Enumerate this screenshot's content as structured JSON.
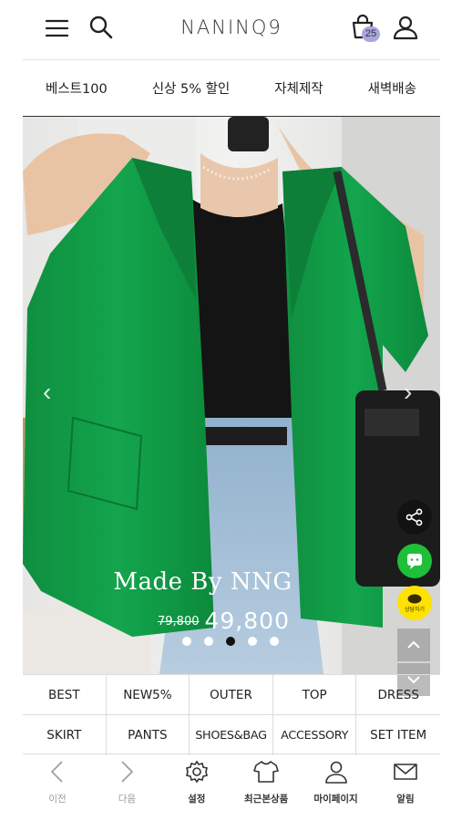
{
  "header": {
    "logo": "NANINQ9",
    "cart_count": "25",
    "icons": [
      "menu-icon",
      "search-icon",
      "cart-icon",
      "user-icon"
    ]
  },
  "category_nav": [
    {
      "label": "베스트100"
    },
    {
      "label": "신상 5% 할인"
    },
    {
      "label": "자체제작"
    },
    {
      "label": "새벽배송"
    }
  ],
  "hero": {
    "title": "Made By NNG",
    "old_price": "79,800",
    "price": "49,800",
    "slide_count": 5,
    "active_slide": 3
  },
  "grid": [
    {
      "label": "BEST"
    },
    {
      "label": "NEW5%"
    },
    {
      "label": "OUTER"
    },
    {
      "label": "TOP"
    },
    {
      "label": "DRESS"
    },
    {
      "label": "SKIRT"
    },
    {
      "label": "PANTS"
    },
    {
      "label": "SHOES&BAG"
    },
    {
      "label": "ACCESSORY"
    },
    {
      "label": "SET ITEM"
    }
  ],
  "floating": {
    "kakao_label": "상담하기"
  },
  "bottom_bar": [
    {
      "label": "이전",
      "icon": "chevron-left-icon",
      "disabled": true
    },
    {
      "label": "다음",
      "icon": "chevron-right-icon",
      "disabled": true
    },
    {
      "label": "설정",
      "icon": "gear-icon"
    },
    {
      "label": "최근본상품",
      "icon": "shirt-icon"
    },
    {
      "label": "마이페이지",
      "icon": "user-icon"
    },
    {
      "label": "알림",
      "icon": "mail-icon"
    }
  ],
  "colors": {
    "jacket_green": "#109a45",
    "badge": "#a8a6df",
    "talk_green": "#1fbf3a",
    "kakao_yellow": "#ffe200"
  }
}
